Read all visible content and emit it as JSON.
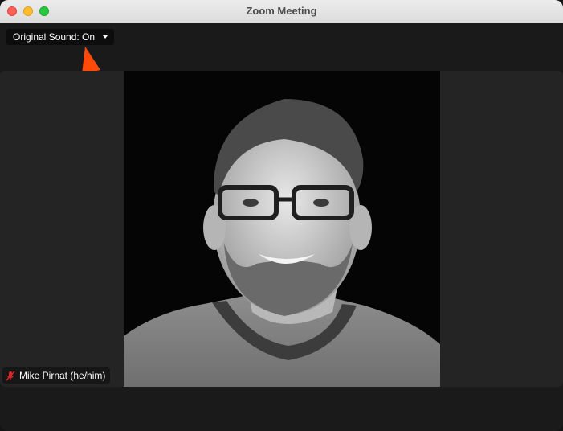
{
  "window": {
    "title": "Zoom Meeting"
  },
  "toolbar": {
    "original_sound_label": "Original Sound: On"
  },
  "participant": {
    "name": "Mike Pirnat (he/him)",
    "muted": true
  },
  "colors": {
    "annotation_arrow": "#ff4a0a",
    "muted_icon": "#e02828"
  },
  "icons": {
    "dropdown": "chevron-down-icon",
    "mic_muted": "mic-muted-icon",
    "annotation": "annotation-arrow-icon"
  }
}
